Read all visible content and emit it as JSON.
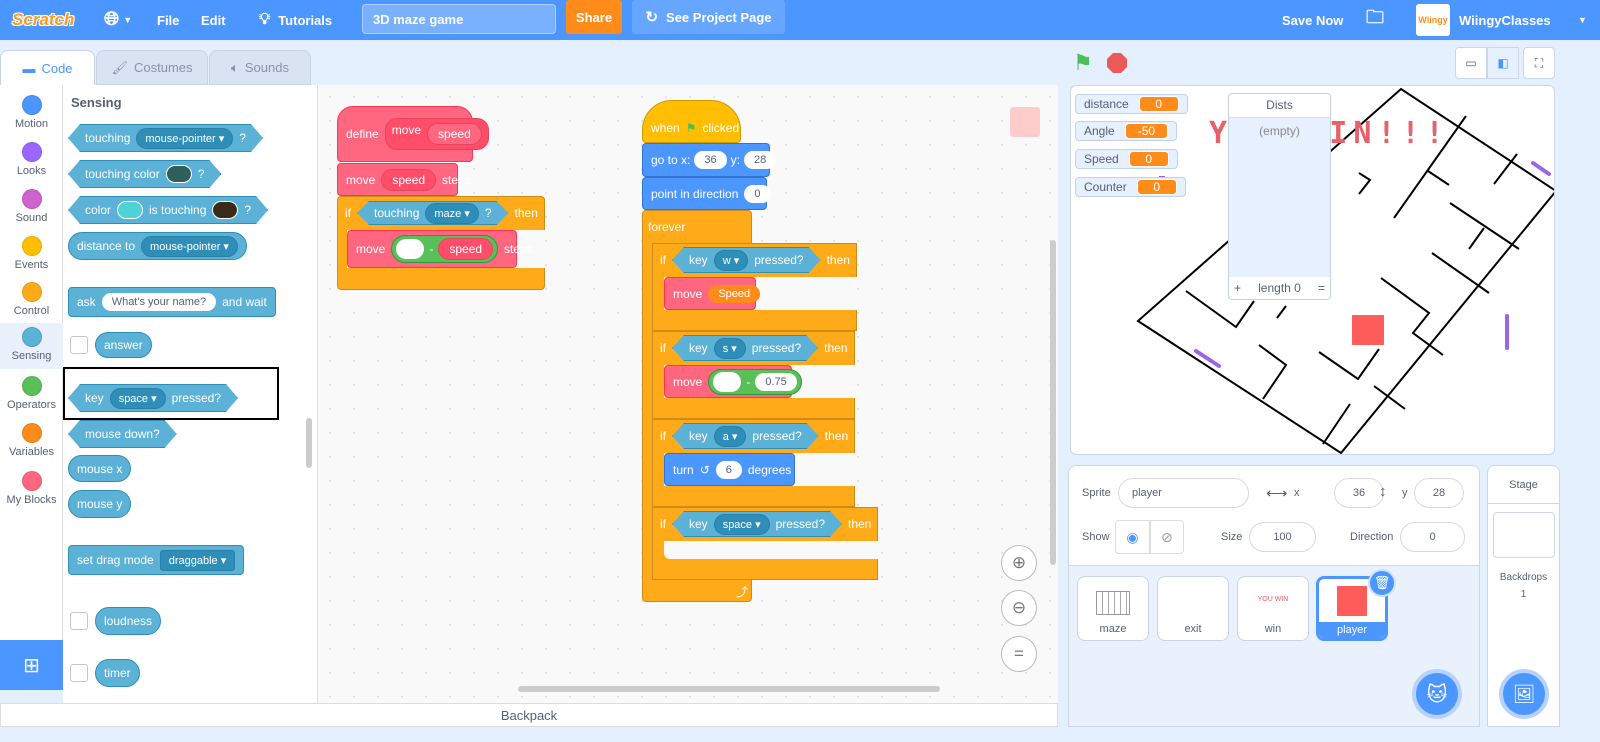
{
  "menubar": {
    "logo": "Scratch",
    "file": "File",
    "edit": "Edit",
    "tutorials": "Tutorials",
    "project_title": "3D maze game",
    "share": "Share",
    "see_project_page": "See Project Page",
    "save_now": "Save Now",
    "username": "WiingyClasses",
    "avatar_text": "Wiingy",
    "color": "#4c97ff"
  },
  "tabs": [
    {
      "label": "Code",
      "selected": true
    },
    {
      "label": "Costumes"
    },
    {
      "label": "Sounds"
    }
  ],
  "categories": [
    {
      "label": "Motion",
      "color": "#4c97ff"
    },
    {
      "label": "Looks",
      "color": "#9966ff"
    },
    {
      "label": "Sound",
      "color": "#cf63cf"
    },
    {
      "label": "Events",
      "color": "#ffbf00"
    },
    {
      "label": "Control",
      "color": "#ffab19"
    },
    {
      "label": "Sensing",
      "color": "#5cb1d6",
      "selected": true
    },
    {
      "label": "Operators",
      "color": "#59c059"
    },
    {
      "label": "Variables",
      "color": "#ff8c1a"
    },
    {
      "label": "My Blocks",
      "color": "#ff6680"
    }
  ],
  "palette": {
    "heading": "Sensing",
    "touching": {
      "text": "touching",
      "menu": "mouse-pointer",
      "end": "?"
    },
    "touching_color": {
      "text": "touching color",
      "end": "?",
      "swatch": "#2f5f5c"
    },
    "color_touching": {
      "a": "color",
      "b": "is touching",
      "end": "?",
      "swatch1": "#4fd1d8",
      "swatch2": "#3a2a1a"
    },
    "distance_to": {
      "text": "distance to",
      "menu": "mouse-pointer"
    },
    "ask": {
      "a": "ask",
      "input": "What's your name?",
      "b": "and wait"
    },
    "answer": "answer",
    "key_pressed": {
      "a": "key",
      "menu": "space",
      "b": "pressed?",
      "highlighted": true
    },
    "mouse_down": "mouse down?",
    "mouse_x": "mouse x",
    "mouse_y": "mouse y",
    "drag_mode": {
      "text": "set drag mode",
      "menu": "draggable"
    },
    "loudness": "loudness",
    "timer": "timer"
  },
  "script1": {
    "define": "define",
    "name": "move",
    "param": "speed",
    "move_steps": {
      "a": "move",
      "param": "speed",
      "b": "steps"
    },
    "if": {
      "a": "if",
      "cond": "touching",
      "menu": "maze",
      "q": "?",
      "then": "then"
    },
    "inner_move": {
      "a": "move",
      "op": "-",
      "param": "speed",
      "b": "steps"
    }
  },
  "script2": {
    "hat": {
      "a": "when",
      "b": "clicked"
    },
    "goto": {
      "a": "go to x:",
      "x": "36",
      "b": "y:",
      "y": "28"
    },
    "point": {
      "a": "point in direction",
      "v": "0"
    },
    "forever": "forever",
    "ifs": [
      {
        "if": "if",
        "key": "key",
        "menu": "w",
        "pressed": "pressed?",
        "then": "then",
        "body": {
          "a": "move",
          "param": "Speed"
        }
      },
      {
        "if": "if",
        "key": "key",
        "menu": "s",
        "pressed": "pressed?",
        "then": "then",
        "body": {
          "a": "move",
          "op": "-",
          "v": "0.75"
        }
      },
      {
        "if": "if",
        "key": "key",
        "menu": "a",
        "pressed": "pressed?",
        "then": "then",
        "body": {
          "a": "turn",
          "v": "6",
          "b": "degrees"
        }
      },
      {
        "if": "if",
        "key": "key",
        "menu": "space",
        "pressed": "pressed?",
        "then": "then"
      }
    ]
  },
  "backpack": "Backpack",
  "stage": {
    "monitors": [
      {
        "label": "distance",
        "value": "0"
      },
      {
        "label": "Angle",
        "value": "-50"
      },
      {
        "label": "Speed",
        "value": "0"
      },
      {
        "label": "Counter",
        "value": "0"
      }
    ],
    "list": {
      "title": "Dists",
      "empty": "(empty)",
      "add": "+",
      "length": "length 0",
      "resize": "="
    },
    "win_text": "YOU WIN!!!"
  },
  "sprite_info": {
    "sprite_label": "Sprite",
    "sprite_name": "player",
    "x_label": "x",
    "x": "36",
    "y_label": "y",
    "y": "28",
    "show_label": "Show",
    "size_label": "Size",
    "size": "100",
    "direction_label": "Direction",
    "direction": "0"
  },
  "sprites": [
    {
      "name": "maze"
    },
    {
      "name": "exit"
    },
    {
      "name": "win",
      "thumb_text": "YOU WIN"
    },
    {
      "name": "player",
      "selected": true
    }
  ],
  "stage_pane": {
    "title": "Stage",
    "backdrops_label": "Backdrops",
    "backdrops_count": "1"
  }
}
